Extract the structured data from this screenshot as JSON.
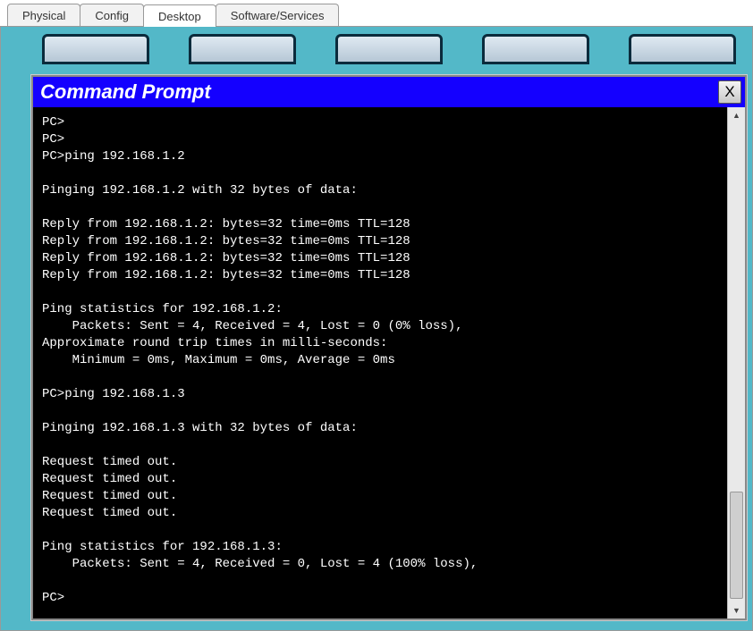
{
  "tabs": {
    "t0": "Physical",
    "t1": "Config",
    "t2": "Desktop",
    "t3": "Software/Services"
  },
  "window": {
    "title": "Command Prompt",
    "close_label": "X"
  },
  "terminal": {
    "lines": [
      "PC>",
      "PC>",
      "PC>ping 192.168.1.2",
      "",
      "Pinging 192.168.1.2 with 32 bytes of data:",
      "",
      "Reply from 192.168.1.2: bytes=32 time=0ms TTL=128",
      "Reply from 192.168.1.2: bytes=32 time=0ms TTL=128",
      "Reply from 192.168.1.2: bytes=32 time=0ms TTL=128",
      "Reply from 192.168.1.2: bytes=32 time=0ms TTL=128",
      "",
      "Ping statistics for 192.168.1.2:",
      "    Packets: Sent = 4, Received = 4, Lost = 0 (0% loss),",
      "Approximate round trip times in milli-seconds:",
      "    Minimum = 0ms, Maximum = 0ms, Average = 0ms",
      "",
      "PC>ping 192.168.1.3",
      "",
      "Pinging 192.168.1.3 with 32 bytes of data:",
      "",
      "Request timed out.",
      "Request timed out.",
      "Request timed out.",
      "Request timed out.",
      "",
      "Ping statistics for 192.168.1.3:",
      "    Packets: Sent = 4, Received = 0, Lost = 4 (100% loss),",
      "",
      "PC>"
    ]
  }
}
